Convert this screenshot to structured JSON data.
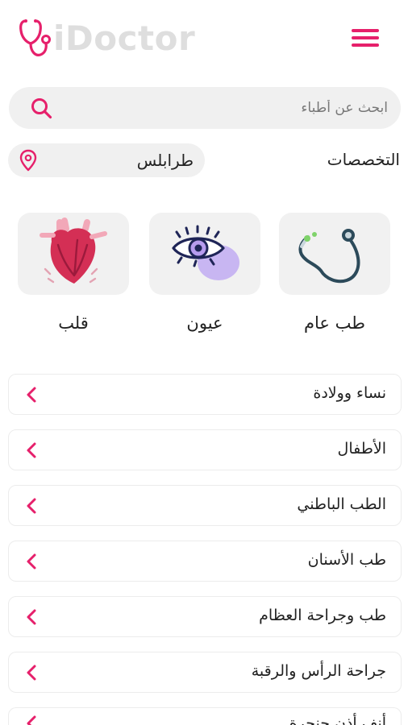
{
  "app": {
    "logo_text": "iDoctor"
  },
  "search": {
    "placeholder": "ابحث عن أطباء"
  },
  "specialties": {
    "title": "التخصصات",
    "location": "طرابلس"
  },
  "categories": [
    {
      "label": "طب عام",
      "icon": "stethoscope-icon"
    },
    {
      "label": "عيون",
      "icon": "eye-icon"
    },
    {
      "label": "قلب",
      "icon": "heart-icon"
    }
  ],
  "list": [
    "نساء وولادة",
    "الأطفال",
    "الطب الباطني",
    "طب الأسنان",
    "طب وجراحة العظام",
    "جراحة الرأس والرقبة",
    "أنف أذن حنجرة"
  ],
  "colors": {
    "accent": "#e6206b",
    "logo_text": "#dedede",
    "card_bg": "#f1f1f1",
    "pill_bg": "#f0f0f0"
  }
}
